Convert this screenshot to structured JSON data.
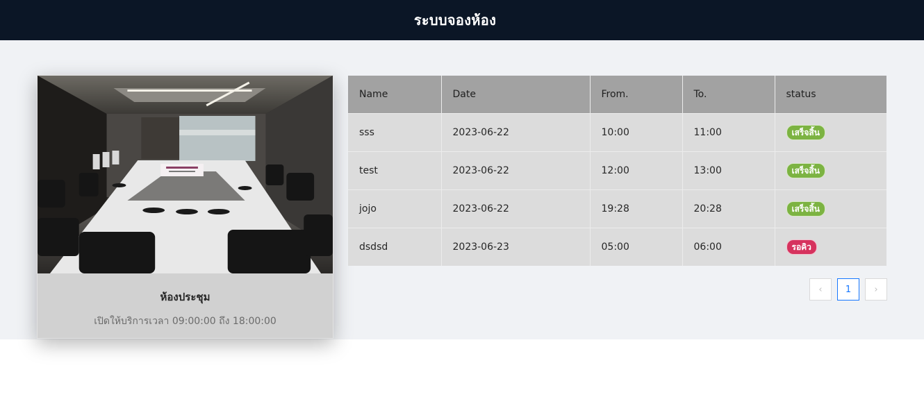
{
  "header": {
    "title": "ระบบจองห้อง"
  },
  "room": {
    "name": "ห้องประชุม",
    "hours": "เปิดให้บริการเวลา 09:00:00 ถึง 18:00:00"
  },
  "table": {
    "columns": [
      "Name",
      "Date",
      "From.",
      "To.",
      "status"
    ],
    "rows": [
      {
        "name": "sss",
        "date": "2023-06-22",
        "from": "10:00",
        "to": "11:00",
        "status": "เสร็จสิ้น",
        "status_color": "#7cb342"
      },
      {
        "name": "test",
        "date": "2023-06-22",
        "from": "12:00",
        "to": "13:00",
        "status": "เสร็จสิ้น",
        "status_color": "#7cb342"
      },
      {
        "name": "jojo",
        "date": "2023-06-22",
        "from": "19:28",
        "to": "20:28",
        "status": "เสร็จสิ้น",
        "status_color": "#7cb342"
      },
      {
        "name": "dsdsd",
        "date": "2023-06-23",
        "from": "05:00",
        "to": "06:00",
        "status": "รอคิว",
        "status_color": "#d6335e"
      }
    ]
  },
  "pagination": {
    "prev_icon": "‹",
    "current_page": "1",
    "next_icon": "›"
  },
  "colors": {
    "header_bg": "#0b1626",
    "accent": "#1677ff",
    "done": "#7cb342",
    "waiting": "#d6335e"
  }
}
